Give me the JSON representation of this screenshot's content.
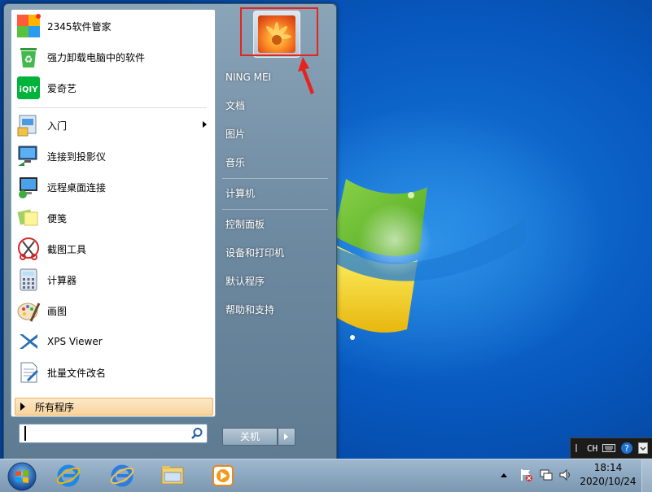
{
  "start_menu": {
    "pinned": [
      {
        "label": "2345软件管家",
        "icon": "software-manager-icon"
      },
      {
        "label": "强力卸载电脑中的软件",
        "icon": "recycle-uninstall-icon"
      },
      {
        "label": "爱奇艺",
        "icon": "iqiyi-icon"
      }
    ],
    "recent": [
      {
        "label": "入门",
        "icon": "getting-started-icon",
        "has_submenu": true
      },
      {
        "label": "连接到投影仪",
        "icon": "projector-icon"
      },
      {
        "label": "远程桌面连接",
        "icon": "remote-desktop-icon"
      },
      {
        "label": "便笺",
        "icon": "sticky-notes-icon"
      },
      {
        "label": "截图工具",
        "icon": "snipping-tool-icon"
      },
      {
        "label": "计算器",
        "icon": "calculator-icon"
      },
      {
        "label": "画图",
        "icon": "paint-icon"
      },
      {
        "label": "XPS Viewer",
        "icon": "xps-viewer-icon"
      },
      {
        "label": "批量文件改名",
        "icon": "batch-rename-icon"
      }
    ],
    "all_programs_label": "所有程序",
    "search": {
      "value": "",
      "placeholder": ""
    },
    "user_name": "NING MEI",
    "right_items": [
      "文档",
      "图片",
      "音乐",
      "计算机",
      "控制面板",
      "设备和打印机",
      "默认程序",
      "帮助和支持"
    ],
    "shutdown_label": "关机"
  },
  "taskbar": {
    "pinned": [
      "internet-explorer-icon",
      "ie-icon",
      "file-explorer-icon",
      "media-player-icon"
    ],
    "time": "18:14",
    "date": "2020/10/24"
  },
  "language_bar": {
    "lang": "CH"
  },
  "colors": {
    "annotation": "#e6241d",
    "all_programs_bg": "#f8d49b"
  }
}
